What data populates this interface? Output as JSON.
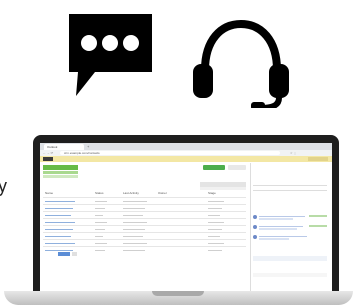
{
  "icons": {
    "chat": "speech-bubble-ellipsis-icon",
    "headset": "headset-icon"
  },
  "edge_text": "y",
  "colors": {
    "icon": "#000000",
    "bezel": "#1e1e1e",
    "app_header": "#f3e7a4",
    "accent_green": "#66bb46",
    "link_blue": "#3b6fb6"
  },
  "browser": {
    "tab_label": "Outlook",
    "new_tab": "+",
    "url": "crm.example.com/contacts",
    "nav_glyphs": "← → ⟳",
    "ext_glyphs": "☆ ⋮"
  },
  "table": {
    "headers": [
      "Name",
      "Status",
      "Last Activity",
      "Owner",
      "Stage"
    ],
    "rows": [
      [
        "",
        "",
        "",
        "",
        ""
      ],
      [
        "",
        "",
        "",
        "",
        ""
      ],
      [
        "",
        "",
        "",
        "",
        ""
      ],
      [
        "",
        "",
        "",
        "",
        ""
      ],
      [
        "",
        "",
        "",
        "",
        ""
      ],
      [
        "",
        "",
        "",
        "",
        ""
      ],
      [
        "",
        "",
        "",
        "",
        ""
      ],
      [
        "",
        "",
        "",
        "",
        ""
      ]
    ]
  }
}
